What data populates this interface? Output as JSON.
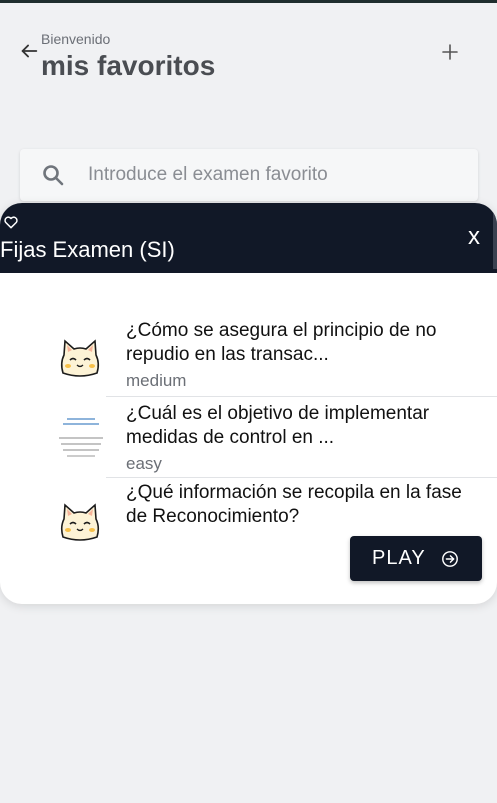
{
  "header": {
    "subtitle": "Bienvenido",
    "title": "mis favoritos",
    "back_icon": "arrow-left-icon",
    "add_icon": "plus-icon"
  },
  "search": {
    "placeholder": "Introduce el examen favorito",
    "value": "",
    "icon": "search-icon"
  },
  "modal": {
    "heart_icon": "heart-outline-icon",
    "title": "Fijas Examen (SI)",
    "close_label": "x",
    "questions": [
      {
        "text": "¿Cómo se asegura el principio de no repudio en las transac...",
        "difficulty": "medium",
        "thumb": "cat-face-icon"
      },
      {
        "text": "¿Cuál es el objetivo de implementar medidas de control en ...",
        "difficulty": "easy",
        "thumb": "document-thumbnail-icon"
      },
      {
        "text": "¿Qué información se recopila en la fase de Reconocimiento?",
        "difficulty": "",
        "thumb": "cat-face-icon"
      }
    ],
    "play_label": "PLAY",
    "play_icon": "arrow-circle-right-icon"
  },
  "colors": {
    "dark": "#111827",
    "background": "#f0f1f3",
    "muted_text": "#6b6f76"
  }
}
